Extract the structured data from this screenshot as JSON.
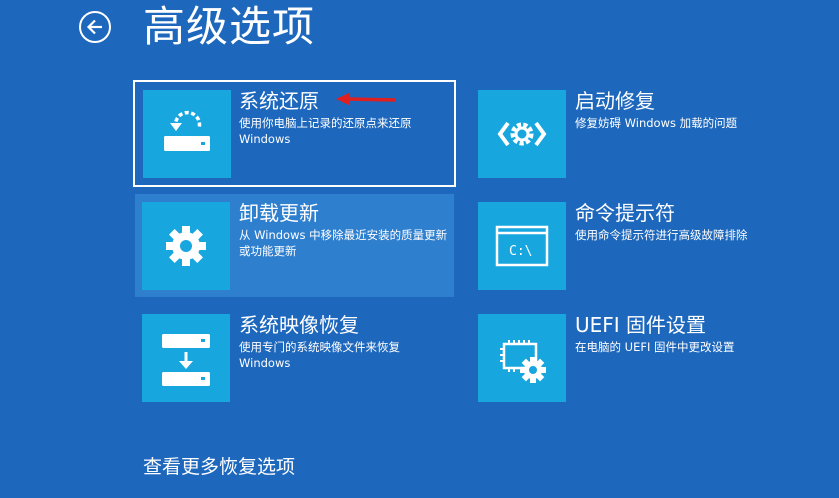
{
  "header": {
    "title": "高级选项",
    "back_icon": "back-arrow-icon"
  },
  "options": [
    {
      "title": "系统还原",
      "description": "使用你电脑上记录的还原点来还原 Windows",
      "icon": "system-restore-icon",
      "state": "selected"
    },
    {
      "title": "启动修复",
      "description": "修复妨碍 Windows 加载的问题",
      "icon": "startup-repair-icon",
      "state": "normal"
    },
    {
      "title": "卸载更新",
      "description": "从 Windows 中移除最近安装的质量更新或功能更新",
      "icon": "gear-icon",
      "state": "hover"
    },
    {
      "title": "命令提示符",
      "description": "使用命令提示符进行高级故障排除",
      "icon": "command-prompt-icon",
      "state": "normal"
    },
    {
      "title": "系统映像恢复",
      "description": "使用专门的系统映像文件来恢复 Windows",
      "icon": "image-recovery-icon",
      "state": "normal"
    },
    {
      "title": "UEFI 固件设置",
      "description": "在电脑的 UEFI 固件中更改设置",
      "icon": "firmware-settings-icon",
      "state": "normal"
    }
  ],
  "footer": {
    "more_link": "查看更多恢复选项"
  },
  "colors": {
    "background": "#1d67bd",
    "tile_icon_bg": "#18a6df",
    "hover_bg": "#2f7fcf",
    "annotation_arrow": "#e02020"
  },
  "annotation": {
    "arrow_icon": "red-arrow-icon"
  }
}
